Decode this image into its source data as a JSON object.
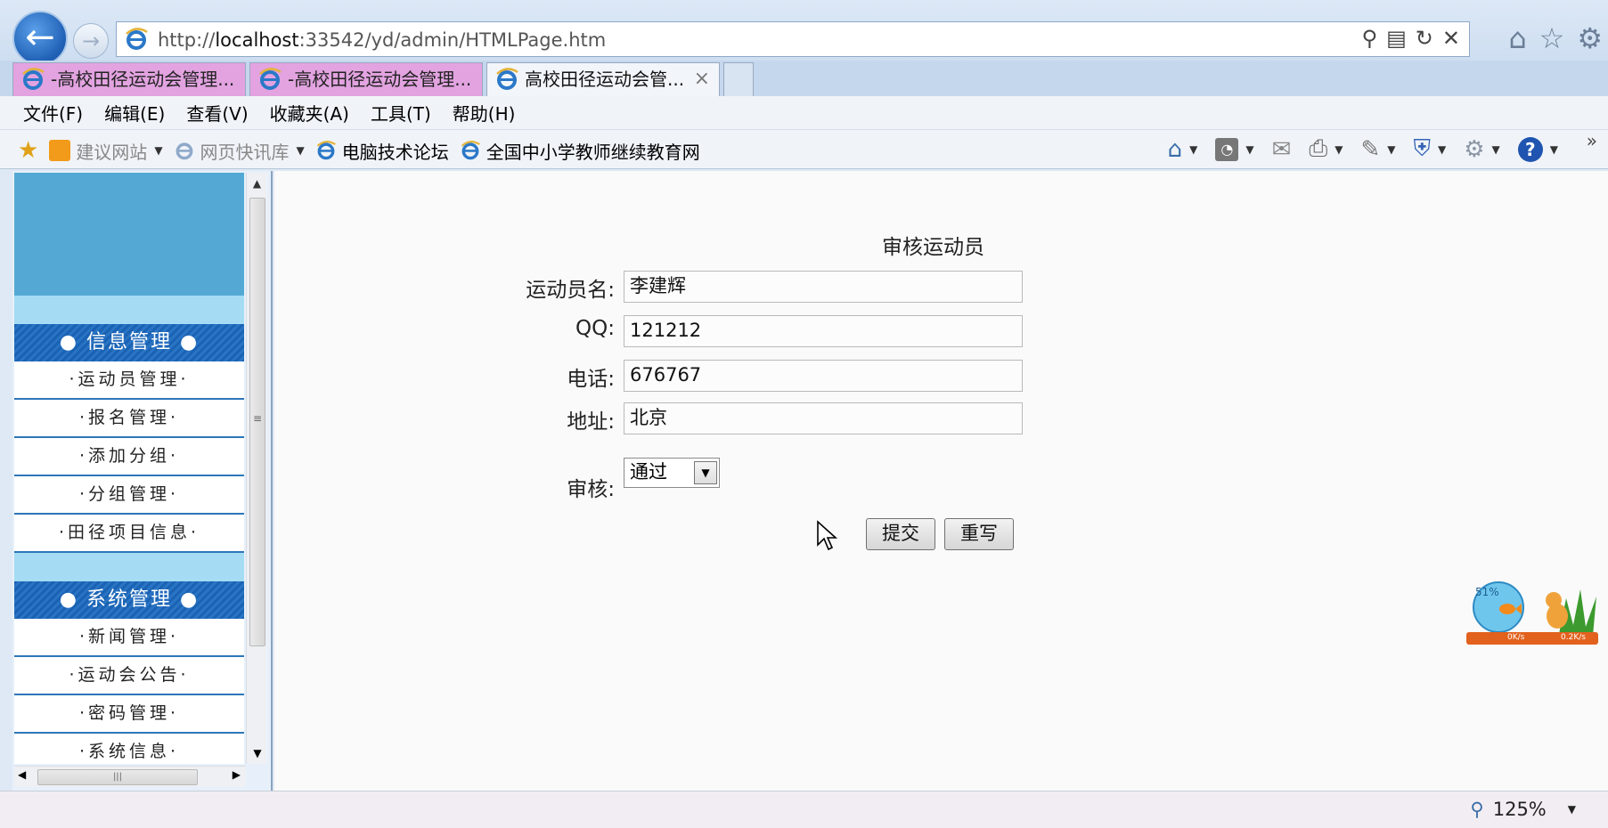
{
  "browser": {
    "url_prefix": "http://",
    "url_host": "localhost",
    "url_rest": ":33542/yd/admin/HTMLPage.htm",
    "tabs": [
      {
        "label": "-高校田径运动会管理..."
      },
      {
        "label": "-高校田径运动会管理..."
      },
      {
        "label": "高校田径运动会管..."
      }
    ],
    "menu": [
      "文件(F)",
      "编辑(E)",
      "查看(V)",
      "收藏夹(A)",
      "工具(T)",
      "帮助(H)"
    ],
    "favorites": [
      {
        "label": "建议网站"
      },
      {
        "label": "网页快讯库"
      },
      {
        "label": "电脑技术论坛"
      },
      {
        "label": "全国中小学教师继续教育网"
      }
    ],
    "zoom": "125%"
  },
  "sidebar": {
    "sections": [
      {
        "title": "● 信息管理 ●",
        "items": [
          "·运动员管理·",
          "·报名管理·",
          "·添加分组·",
          "·分组管理·",
          "·田径项目信息·"
        ]
      },
      {
        "title": "● 系统管理 ●",
        "items": [
          "·新闻管理·",
          "·运动会公告·",
          "·密码管理·",
          "·系统信息·"
        ]
      }
    ]
  },
  "form": {
    "title": "审核运动员",
    "name_label": "运动员名:",
    "name_value": "李建辉",
    "qq_label": "QQ:",
    "qq_value": "121212",
    "phone_label": "电话:",
    "phone_value": "676767",
    "address_label": "地址:",
    "address_value": "北京",
    "review_label": "审核:",
    "review_selected": "通过",
    "submit_label": "提交",
    "reset_label": "重写"
  },
  "widget": {
    "percent": "51%",
    "down": "0K/s",
    "up": "0.2K/s"
  },
  "colors": {
    "sidebar_header": "#1a62b3",
    "sidebar_top": "#54a9d4",
    "sidebar_band": "#a5dcf3",
    "tab_inactive": "#e2a3e0"
  }
}
